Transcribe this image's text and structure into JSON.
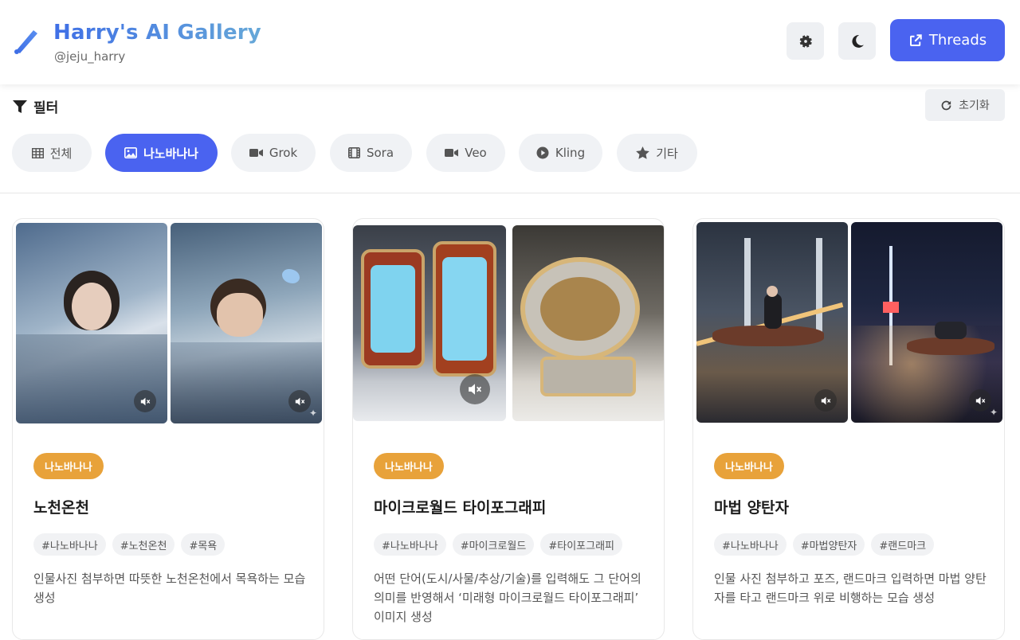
{
  "header": {
    "title": "Harry's AI Gallery",
    "subtitle": "@jeju_harry",
    "threads_label": "Threads",
    "brand_icon": "pen-icon",
    "settings_icon": "gear-icon",
    "theme_icon": "moon-icon",
    "threads_icon": "external-link-icon"
  },
  "filter": {
    "label": "필터",
    "reset_label": "초기화",
    "chips": [
      {
        "label": "전체",
        "icon": "grid-icon",
        "active": false
      },
      {
        "label": "나노바나나",
        "icon": "image-icon",
        "active": true
      },
      {
        "label": "Grok",
        "icon": "video-camera-icon",
        "active": false
      },
      {
        "label": "Sora",
        "icon": "film-icon",
        "active": false
      },
      {
        "label": "Veo",
        "icon": "video-camera-icon",
        "active": false
      },
      {
        "label": "Kling",
        "icon": "play-circle-icon",
        "active": false
      },
      {
        "label": "기타",
        "icon": "star-icon",
        "active": false
      }
    ]
  },
  "cards": [
    {
      "badge": "나노바나나",
      "title": "노천온천",
      "tags": [
        "#나노바나나",
        "#노천온천",
        "#목욕"
      ],
      "description": "인물사진 첨부하면 따뜻한 노천온천에서 목욕하는 모습 생성"
    },
    {
      "badge": "나노바나나",
      "title": "마이크로월드 타이포그래피",
      "tags": [
        "#나노바나나",
        "#마이크로월드",
        "#타이포그래피"
      ],
      "description": "어떤 단어(도시/사물/추상/기술)를 입력해도 그 단어의 의미를 반영해서 ‘미래형 마이크로월드 타이포그래피’ 이미지 생성"
    },
    {
      "badge": "나노바나나",
      "title": "마법 양탄자",
      "tags": [
        "#나노바나나",
        "#마법양탄자",
        "#랜드마크"
      ],
      "description": "인물 사진 첨부하고 포즈, 랜드마크 입력하면 마법 양탄자를 타고 랜드마크 위로 비행하는 모습 생성"
    }
  ],
  "colors": {
    "accent": "#4a63f0",
    "badge": "#e8a23a"
  }
}
